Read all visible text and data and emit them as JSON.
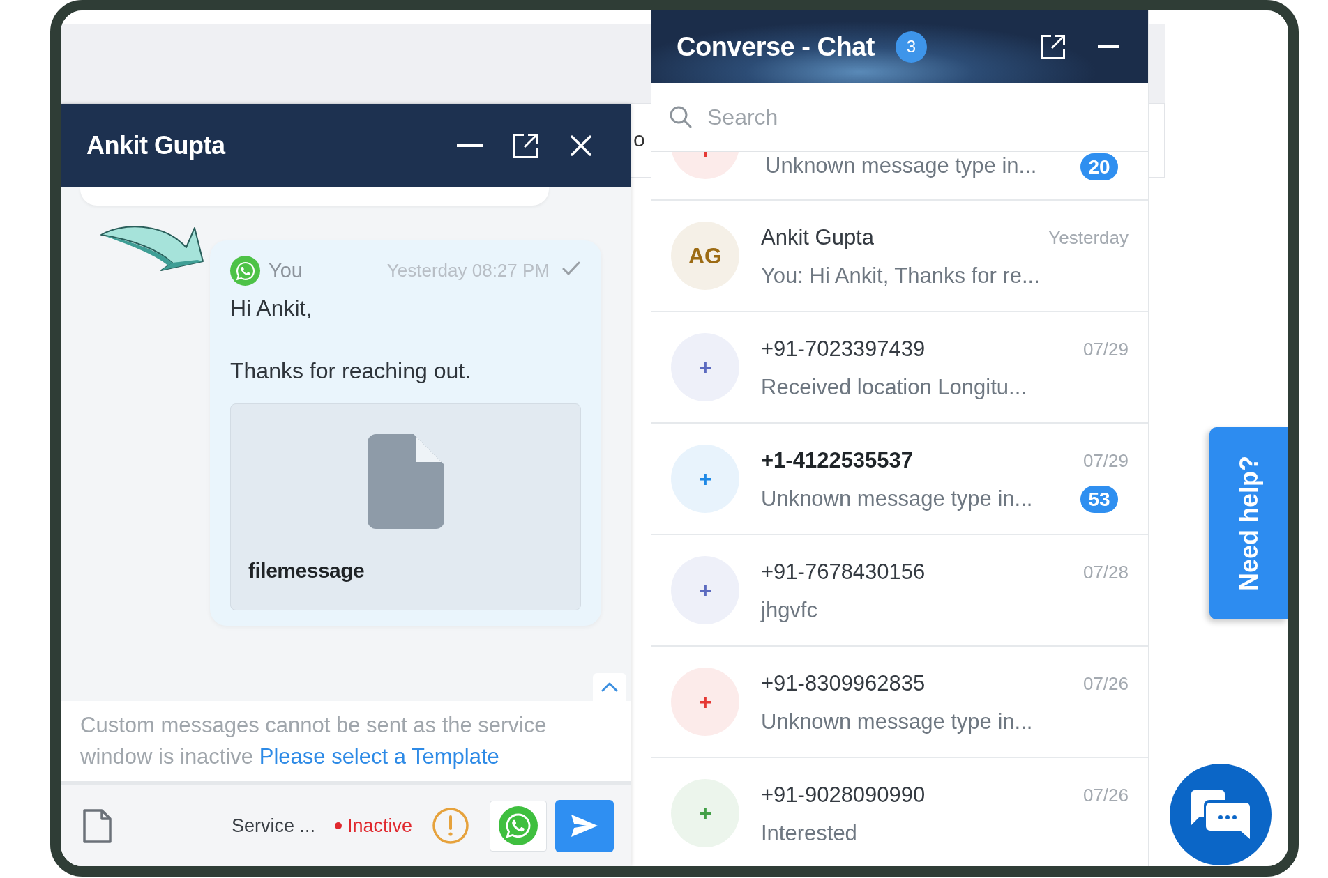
{
  "background_page": {
    "text_fragment": "o"
  },
  "chat_window": {
    "title": "Ankit Gupta",
    "message": {
      "sender": "You",
      "time": "Yesterday 08:27 PM",
      "delivered": true,
      "text": "Hi Ankit,\n\nThanks for reaching out.",
      "attachment": {
        "file_name": "filemessage"
      }
    },
    "notice": {
      "text": "Custom messages cannot be sent as the service window is inactive",
      "link": "Please select a Template"
    },
    "footer": {
      "service_label": "Service ...",
      "status": {
        "label": "Inactive",
        "active": false
      }
    }
  },
  "conversation_panel": {
    "title": "Converse - Chat",
    "badge": "3",
    "search": {
      "placeholder": "Search"
    },
    "conversations": [
      {
        "kind": "cut_off",
        "color": "#e53935",
        "preview": "Unknown message type in...",
        "badge": "20"
      },
      {
        "kind": "full",
        "initials": "AG",
        "color": "#9c6b14",
        "name": "Ankit Gupta",
        "date": "Yesterday",
        "preview": "You: Hi Ankit, Thanks for re...",
        "unread": false
      },
      {
        "kind": "full",
        "initials": "+",
        "color": "#5c6bc0",
        "name": "+91-7023397439",
        "date": "07/29",
        "preview": "Received location Longitu...",
        "unread": false
      },
      {
        "kind": "full",
        "initials": "+",
        "color": "#1e88e5",
        "name": "+1-4122535537",
        "date": "07/29",
        "preview": "Unknown message type in...",
        "badge": "53",
        "unread": true
      },
      {
        "kind": "full",
        "initials": "+",
        "color": "#5c6bc0",
        "name": "+91-7678430156",
        "date": "07/28",
        "preview": "jhgvfc",
        "unread": false
      },
      {
        "kind": "full",
        "initials": "+",
        "color": "#e53935",
        "name": "+91-8309962835",
        "date": "07/26",
        "preview": "Unknown message type in...",
        "unread": false
      },
      {
        "kind": "full",
        "initials": "+",
        "color": "#43a047",
        "name": "+91-9028090990",
        "date": "07/26",
        "preview": "Interested",
        "unread": false
      }
    ]
  },
  "help_tab": {
    "label": "Need help?"
  }
}
